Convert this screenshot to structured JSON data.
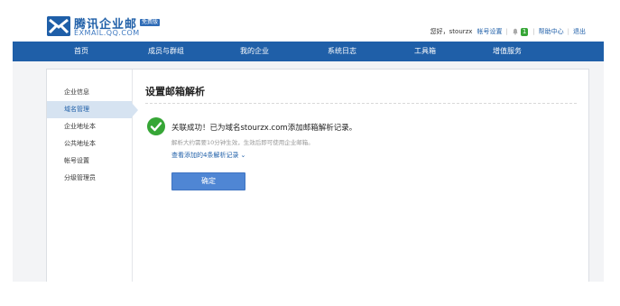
{
  "header": {
    "logo_title": "腾讯企业邮",
    "logo_badge": "免费版",
    "logo_subtitle": "EXMAIL.QQ.COM",
    "greeting": "您好，stourzx",
    "account_settings": "帐号设置",
    "notification_count": "1",
    "help_center": "帮助中心",
    "logout": "退出"
  },
  "nav": {
    "items": [
      {
        "label": "首页"
      },
      {
        "label": "成员与群组"
      },
      {
        "label": "我的企业"
      },
      {
        "label": "系统日志"
      },
      {
        "label": "工具箱"
      },
      {
        "label": "增值服务"
      }
    ]
  },
  "sidebar": {
    "items": [
      {
        "label": "企业信息",
        "active": false
      },
      {
        "label": "域名管理",
        "active": true
      },
      {
        "label": "企业地址本",
        "active": false
      },
      {
        "label": "公共地址本",
        "active": false
      },
      {
        "label": "帐号设置",
        "active": false
      },
      {
        "label": "分级管理员",
        "active": false
      }
    ]
  },
  "main": {
    "title": "设置邮箱解析",
    "success_message": "关联成功！已为域名stourzx.com添加邮箱解析记录。",
    "note": "解析大约需要10分钟生效，生效后即可使用企业邮箱。",
    "view_records": "查看添加的4条解析记录",
    "confirm_button": "确定"
  },
  "colors": {
    "brand": "#1f5fa8",
    "button": "#4f86d4",
    "success": "#36a636",
    "active_item_bg": "#d6e3f1"
  }
}
